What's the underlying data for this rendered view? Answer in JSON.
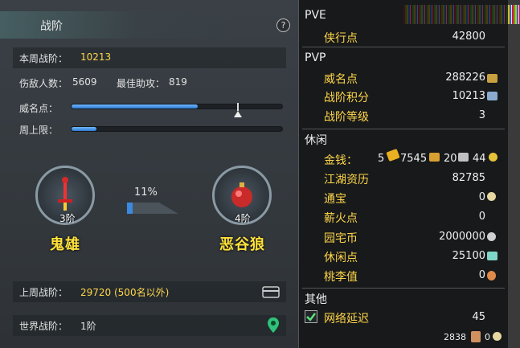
{
  "left_panel": {
    "title": "战阶",
    "help_label": "?",
    "weekly": {
      "label": "本周战阶：",
      "value": "10213"
    },
    "stats": {
      "enemies_label": "伤敌人数：",
      "enemies_value": "5609",
      "assist_label": "最佳助攻：",
      "assist_value": "819"
    },
    "prestige": {
      "label": "威名点：",
      "progress": 0.6
    },
    "weekly_cap": {
      "label": "周上限：",
      "progress": 0.12
    },
    "ranks": {
      "left": {
        "tier": "3阶",
        "name": "鬼雄"
      },
      "right": {
        "tier": "4阶",
        "name": "恶谷狼"
      },
      "progress_text": "11%",
      "progress": 0.11
    },
    "last_week": {
      "label": "上周战阶：",
      "value": "29720 (500名以外)"
    },
    "world": {
      "label": "世界战阶：",
      "value": "1阶"
    }
  },
  "right_panel": {
    "pve": {
      "header": "PVE",
      "items": [
        {
          "label": "侠行点",
          "value": "42800"
        }
      ]
    },
    "pvp": {
      "header": "PVP",
      "items": [
        {
          "label": "威名点",
          "value": "288226"
        },
        {
          "label": "战阶积分",
          "value": "10213"
        },
        {
          "label": "战阶等级",
          "value": "3"
        }
      ]
    },
    "leisure": {
      "header": "休闲",
      "money": {
        "label": "金钱：",
        "gold": "5",
        "silver": "7545",
        "copper": "20",
        "coin": "44"
      },
      "items": [
        {
          "label": "江湖资历",
          "value": "82785"
        },
        {
          "label": "通宝",
          "value": "0"
        },
        {
          "label": "薪火点",
          "value": "0"
        },
        {
          "label": "园宅币",
          "value": "2000000"
        },
        {
          "label": "休闲点",
          "value": "25100"
        },
        {
          "label": "桃李值",
          "value": "0"
        }
      ]
    },
    "other": {
      "header": "其他",
      "latency": {
        "label": "网络延迟",
        "value": "45",
        "checked": true
      }
    },
    "footer": {
      "value_a": "2838",
      "value_b": "0"
    }
  },
  "colors": {
    "accent_yellow": "#ffd64a",
    "bar_blue": "#3a8ae0",
    "panel_dark": "#33383d"
  }
}
